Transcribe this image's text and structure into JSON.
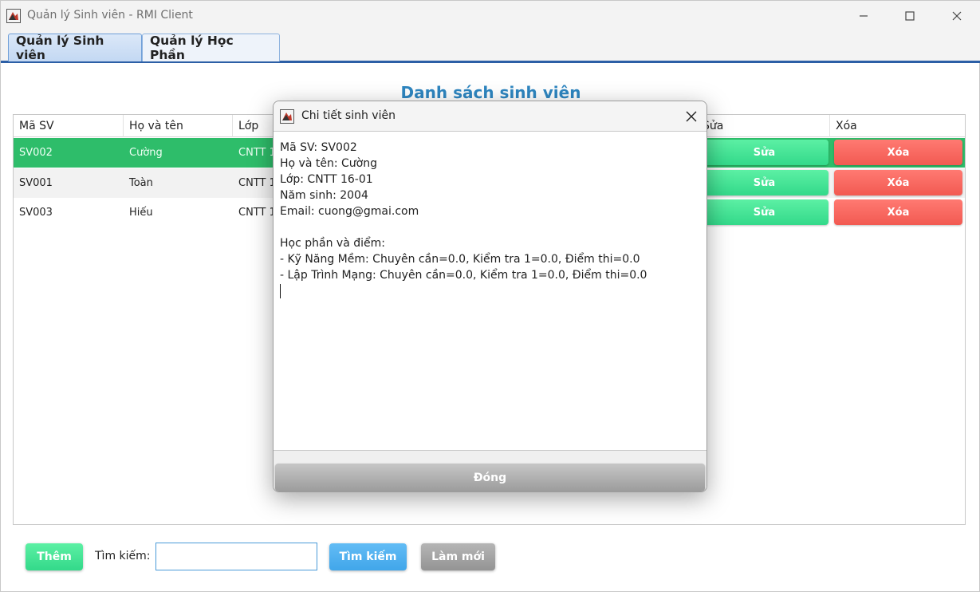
{
  "window": {
    "title": "Quản lý Sinh viên - RMI Client"
  },
  "tabs": [
    {
      "label": "Quản lý Sinh viên",
      "active": true
    },
    {
      "label": "Quản lý Học Phần",
      "active": false
    }
  ],
  "main": {
    "heading": "Danh sách sinh viên"
  },
  "table": {
    "columns": [
      "Mã SV",
      "Họ và tên",
      "Lớp",
      "Sửa",
      "Xóa"
    ],
    "rows": [
      {
        "id": "SV002",
        "name": "Cường",
        "class": "CNTT 1",
        "edit_label": "Sửa",
        "delete_label": "Xóa",
        "selected": true
      },
      {
        "id": "SV001",
        "name": "Toàn",
        "class": "CNTT 1",
        "edit_label": "Sửa",
        "delete_label": "Xóa",
        "selected": false
      },
      {
        "id": "SV003",
        "name": "Hiếu",
        "class": "CNTT 1",
        "edit_label": "Sửa",
        "delete_label": "Xóa",
        "selected": false
      }
    ]
  },
  "controls": {
    "add_label": "Thêm",
    "search_label": "Tìm kiếm:",
    "search_value": "",
    "search_button": "Tìm kiếm",
    "refresh_button": "Làm mới"
  },
  "dialog": {
    "title": "Chi tiết sinh viên",
    "lines": [
      "Mã SV: SV002",
      "Họ và tên: Cường",
      "Lớp: CNTT 16-01",
      "Năm sinh: 2004",
      "Email: cuong@gmai.com",
      "",
      "Học phần và điểm:",
      "- Kỹ Năng Mềm: Chuyên cần=0.0, Kiểm tra 1=0.0, Điểm thi=0.0",
      "- Lập Trình Mạng: Chuyên cần=0.0, Kiểm tra 1=0.0, Điểm thi=0.0"
    ],
    "close_button": "Đóng"
  },
  "colors": {
    "selected_row": "#2ebd6a",
    "edit_button": "#33d98a",
    "delete_button": "#f25a52",
    "heading": "#2e86c1",
    "add_button": "#33d98a",
    "search_button": "#4aaef0",
    "refresh_button": "#a0a0a0"
  }
}
